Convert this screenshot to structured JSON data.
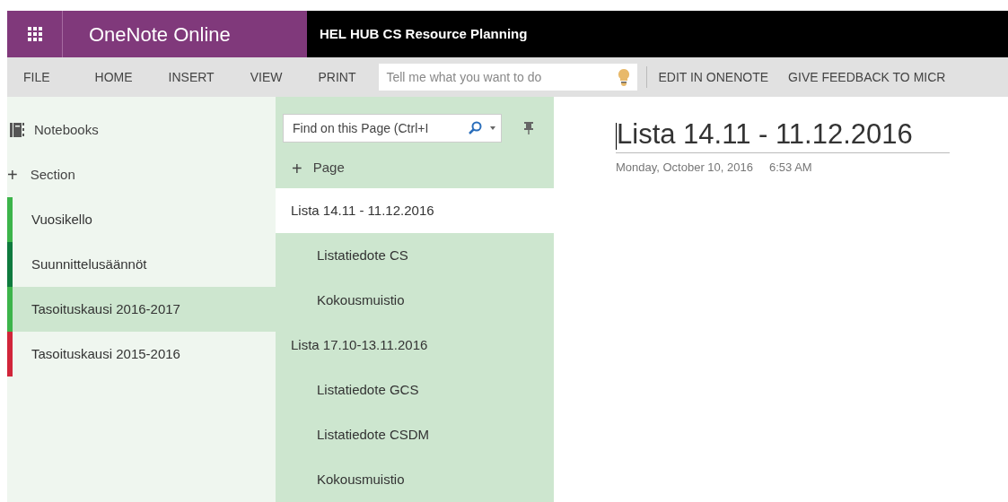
{
  "app_bar": {
    "app_name": "OneNote Online",
    "notebook_title": "HEL HUB CS Resource Planning"
  },
  "ribbon": {
    "tabs": [
      "FILE",
      "HOME",
      "INSERT",
      "VIEW",
      "PRINT"
    ],
    "tell_me": {
      "placeholder": "Tell me what you want to do"
    },
    "actions": [
      "EDIT IN ONENOTE",
      "GIVE FEEDBACK TO MICR"
    ]
  },
  "sections_pane": {
    "notebooks_label": "Notebooks",
    "add_section": "Section",
    "add_icon": "+",
    "sections": [
      {
        "name": "Vuosikello",
        "color": "#3cb44a",
        "selected": false
      },
      {
        "name": "Suunnittelusäännöt",
        "color": "#0e7a3e",
        "selected": false
      },
      {
        "name": "Tasoituskausi 2016-2017",
        "color": "#3cb44a",
        "selected": true
      },
      {
        "name": "Tasoituskausi 2015-2016",
        "color": "#d1253a",
        "selected": false
      }
    ]
  },
  "pages_pane": {
    "find": {
      "placeholder": "Find on this Page (Ctrl+I"
    },
    "add_page": "Page",
    "add_icon": "+",
    "pages": [
      {
        "title": "Lista 14.11 - 11.12.2016",
        "selected": true,
        "children": [
          {
            "title": "Listatiedote CS",
            "selected": false
          },
          {
            "title": "Kokousmuistio",
            "selected": false
          }
        ]
      },
      {
        "title": "Lista 17.10-13.11.2016",
        "selected": false,
        "children": [
          {
            "title": "Listatiedote GCS",
            "selected": false
          },
          {
            "title": "Listatiedote CSDM",
            "selected": false
          },
          {
            "title": "Kokousmuistio",
            "selected": false
          }
        ]
      }
    ]
  },
  "page": {
    "title": "Lista 14.11 - 11.12.2016",
    "date": "Monday, October 10, 2016",
    "time": "6:53 AM"
  }
}
